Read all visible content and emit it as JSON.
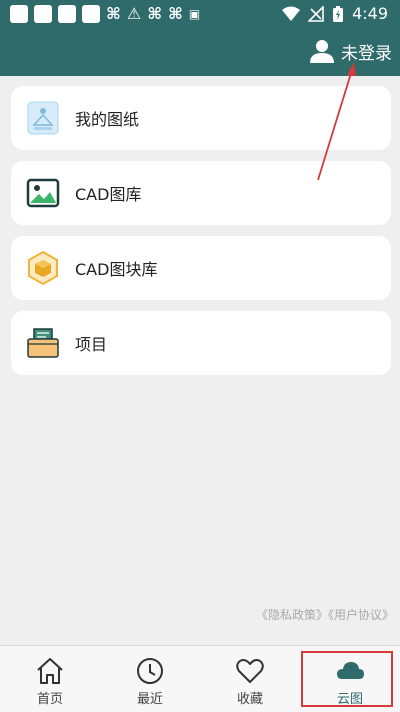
{
  "status_bar": {
    "time": "4:49"
  },
  "header": {
    "login_label": "未登录"
  },
  "menu": [
    {
      "label": "我的图纸",
      "icon": "drawing-icon"
    },
    {
      "label": "CAD图库",
      "icon": "image-gallery-icon"
    },
    {
      "label": "CAD图块库",
      "icon": "cube-block-icon"
    },
    {
      "label": "项目",
      "icon": "project-folder-icon"
    }
  ],
  "footer": {
    "policy": "《隐私政策》《用户协议》"
  },
  "nav": [
    {
      "label": "首页",
      "icon": "home-icon"
    },
    {
      "label": "最近",
      "icon": "clock-icon"
    },
    {
      "label": "收藏",
      "icon": "heart-icon"
    },
    {
      "label": "云图",
      "icon": "cloud-icon"
    }
  ],
  "colors": {
    "header_bg": "#2f6b6b",
    "annotation_red": "#d63b3b"
  }
}
